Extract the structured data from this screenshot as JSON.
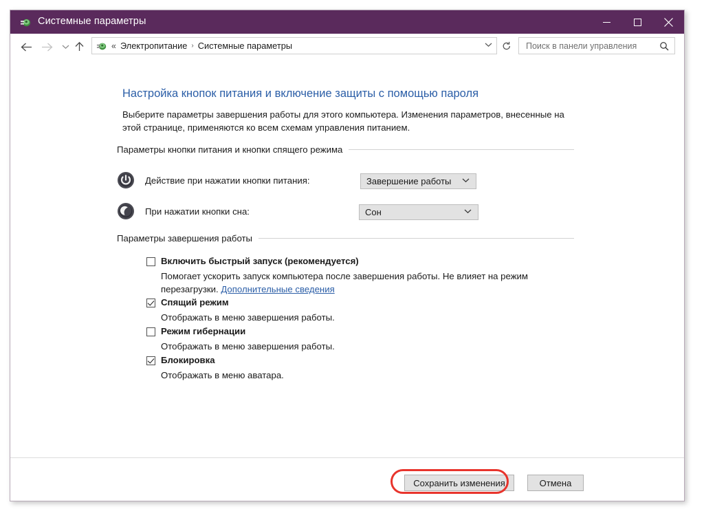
{
  "window": {
    "title": "Системные параметры",
    "title_icon": "power-options-icon",
    "controls": {
      "minimize": "minimize-icon",
      "maximize": "maximize-icon",
      "close": "close-icon"
    }
  },
  "addressbar": {
    "back": "back-arrow-icon",
    "forward": "forward-arrow-icon",
    "recent": "recent-pages-chevron-icon",
    "up": "up-arrow-icon",
    "crumb_icon": "power-options-icon",
    "prefix": "«",
    "crumbs": [
      "Электропитание",
      "Системные параметры"
    ],
    "separator": "›",
    "dropdown": "chevron-down-icon",
    "refresh": "refresh-icon"
  },
  "search": {
    "placeholder": "Поиск в панели управления",
    "value": "",
    "icon": "search-icon"
  },
  "page": {
    "title": "Настройка кнопок питания и включение защиты с помощью пароля",
    "description": "Выберите параметры завершения работы для этого компьютера. Изменения параметров, внесенные на этой странице, применяются ко всем схемам управления питанием."
  },
  "group_power_buttons": {
    "header": "Параметры кнопки питания и кнопки спящего режима",
    "rows": [
      {
        "icon": "power-button-icon",
        "label": "Действие при нажатии кнопки питания:",
        "value": "Завершение работы",
        "arrow": "chevron-down-icon"
      },
      {
        "icon": "sleep-button-icon",
        "label": "При нажатии кнопки сна:",
        "value": "Сон",
        "arrow": "chevron-down-icon"
      }
    ]
  },
  "group_shutdown": {
    "header": "Параметры завершения работы",
    "items": [
      {
        "label": "Включить быстрый запуск (рекомендуется)",
        "checked": false,
        "description": "Помогает ускорить запуск компьютера после завершения работы. Не влияет на режим перезагрузки. ",
        "link": "Дополнительные сведения"
      },
      {
        "label": "Спящий режим",
        "checked": true,
        "description": "Отображать в меню завершения работы.",
        "link": ""
      },
      {
        "label": "Режим гибернации",
        "checked": false,
        "description": "Отображать в меню завершения работы.",
        "link": ""
      },
      {
        "label": "Блокировка",
        "checked": true,
        "description": "Отображать в меню аватара.",
        "link": ""
      }
    ]
  },
  "footer": {
    "save_label": "Сохранить изменения",
    "cancel_label": "Отмена"
  },
  "annotation": {
    "highlight_color": "#e8342c",
    "target": "save-button"
  },
  "colors": {
    "titlebar": "#5a2a5c",
    "link": "#2b5ea7",
    "heading": "#2b5ea7",
    "combo_bg": "#e2e2e2"
  }
}
